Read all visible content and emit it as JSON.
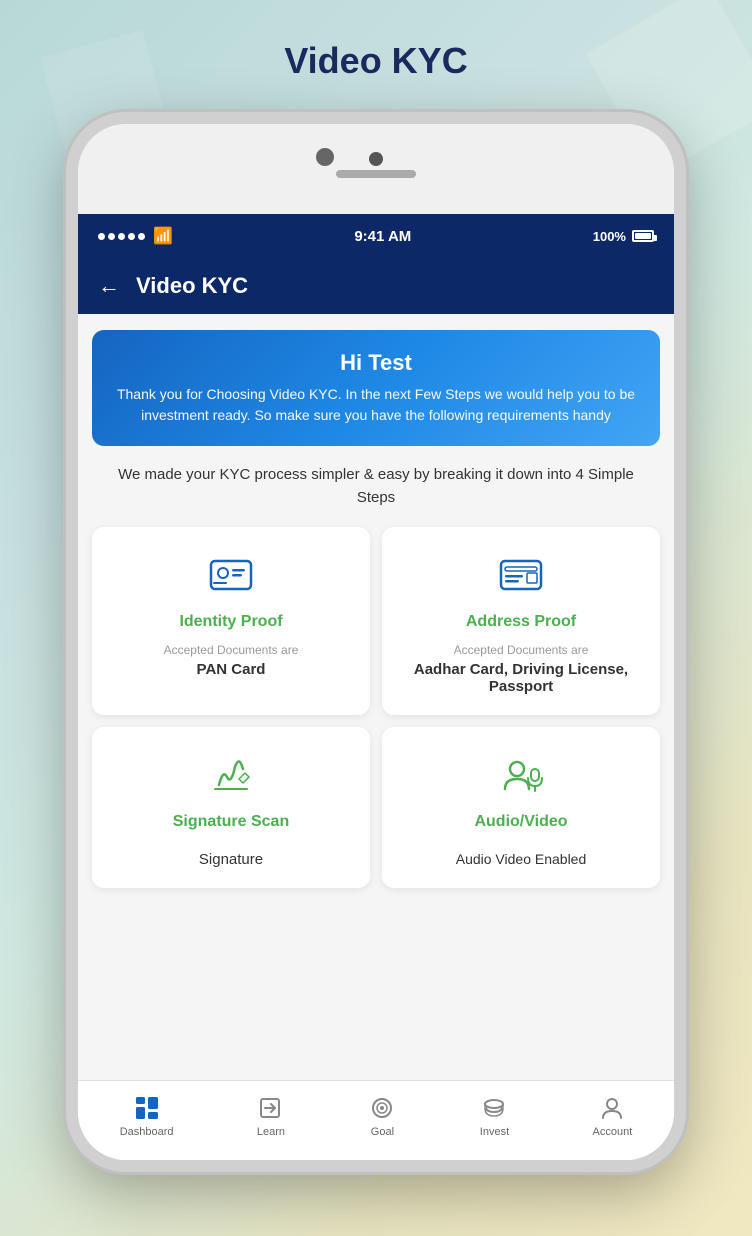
{
  "page": {
    "title": "Video KYC"
  },
  "phone": {
    "status_bar": {
      "time": "9:41 AM",
      "battery": "100%",
      "signal_dots": 5
    }
  },
  "header": {
    "back_label": "←",
    "title": "Video KYC"
  },
  "banner": {
    "greeting": "Hi Test",
    "description": "Thank you for Choosing Video KYC. In the next Few Steps we would help you to be investment ready. So make sure you have the following requirements handy"
  },
  "info_text": "We made your KYC process simpler & easy by breaking it down into 4 Simple Steps",
  "cards": [
    {
      "id": "identity",
      "title": "Identity Proof",
      "subtitle": "Accepted Documents are",
      "document": "PAN Card"
    },
    {
      "id": "address",
      "title": "Address Proof",
      "subtitle": "Accepted Documents are",
      "document": "Aadhar Card, Driving License, Passport"
    },
    {
      "id": "signature",
      "title": "Signature Scan",
      "subtitle": "",
      "document": "Signature"
    },
    {
      "id": "audio-video",
      "title": "Audio/Video",
      "subtitle": "",
      "document": "Audio Video Enabled"
    }
  ],
  "bottom_nav": [
    {
      "id": "dashboard",
      "label": "Dashboard"
    },
    {
      "id": "learn",
      "label": "Learn"
    },
    {
      "id": "goal",
      "label": "Goal"
    },
    {
      "id": "invest",
      "label": "Invest"
    },
    {
      "id": "account",
      "label": "Account"
    }
  ]
}
